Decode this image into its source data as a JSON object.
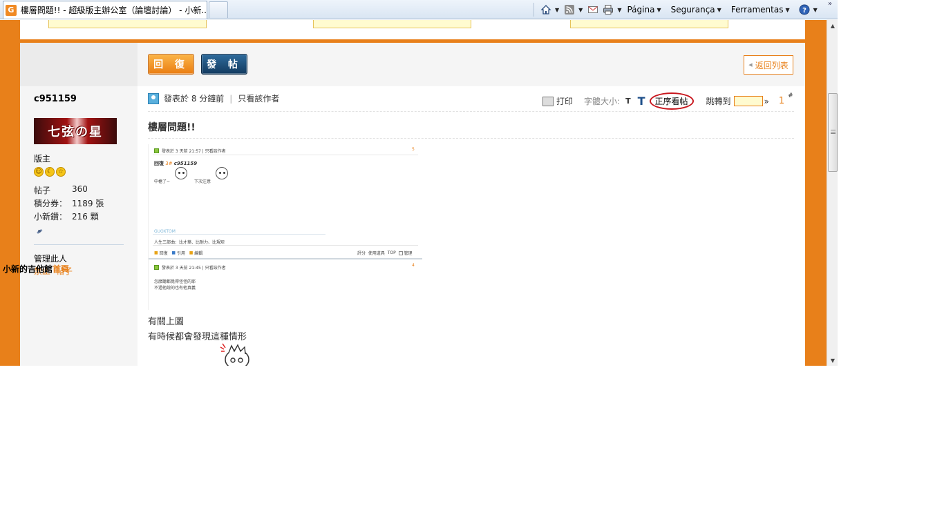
{
  "browser": {
    "tab_title": "樓層問題!! - 超級版主辦公室（論壇討論） - 小新...",
    "favicon_letter": "G",
    "menus": [
      "Página",
      "Segurança",
      "Ferramentas"
    ],
    "overflow_glyph": "»"
  },
  "toolbar": {
    "reply_label": "回 復",
    "post_label": "發 帖",
    "back_label": "返回列表"
  },
  "author": {
    "username": "c951159",
    "banner_text": "七弦の星",
    "role": "版主",
    "stats": [
      {
        "label": "帖子",
        "value": "360"
      },
      {
        "label": "積分券：",
        "value": "1189 張"
      },
      {
        "label": "小新鑽：",
        "value": "216 顆"
      }
    ],
    "manage_label": "管理此人",
    "manage_links": [
      "禁止",
      "帖子"
    ],
    "overlay_text": "小新的吉他館",
    "overlay_accent": "首頁"
  },
  "post": {
    "meta": {
      "posted": "發表於 8 分鐘前",
      "only_author": "只看該作者"
    },
    "tools": {
      "print": "打印",
      "font_size": "字體大小:",
      "t_small": "T",
      "t_large": "T",
      "order": "正序看帖",
      "jump_label": "跳轉到",
      "jump_arrow": "»",
      "floor": "1",
      "floor_mark": "#"
    },
    "title": "樓層問題!!",
    "body_lines": [
      "有關上圖",
      "有時候都會發現這種情形"
    ],
    "embedded": {
      "row1_meta": "發表於 3 天前 21:57 | 只看該作者",
      "row1_floor": "5",
      "reply_prefix": "回復",
      "reply_floor": "3#",
      "reply_user": "c951159",
      "line_left": "中槍了~",
      "line_right": "下次注意",
      "signature_link": "GUOXTOM",
      "signature_text": "人生三部曲：比才華、比耐力、比規矩",
      "actions": [
        "回復",
        "引用",
        "編輯"
      ],
      "right_actions": [
        "評分",
        "使用道具",
        "TOP",
        "管理"
      ],
      "row2_meta": "發表於 3 天前 21:45 | 只看該作者",
      "row2_floor": "4",
      "row2_text1": "怎麼聽都覺得怪怪的耶",
      "row2_text2": "不過他說的也有他真義"
    }
  },
  "colors": {
    "accent_orange": "#e8801a",
    "button_blue": "#123a5f",
    "highlight_red": "#c8161d"
  }
}
